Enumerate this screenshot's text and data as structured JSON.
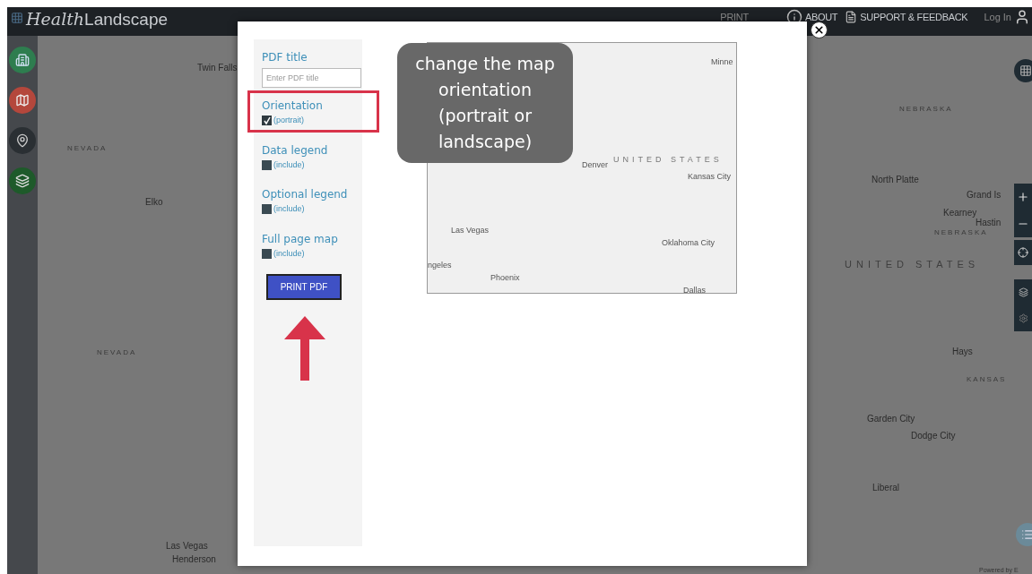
{
  "header": {
    "logo": {
      "italic_part": "Health",
      "rest": "Landscape"
    },
    "nav": [
      {
        "label": "PRINT",
        "kind": "print"
      },
      {
        "label": "ABOUT",
        "kind": "about"
      },
      {
        "label": "SUPPORT & FEEDBACK",
        "kind": "support"
      }
    ],
    "login": "Log In"
  },
  "map": {
    "labels": [
      {
        "text": "Twin Falls",
        "kind": "city"
      },
      {
        "text": "NEVADA",
        "kind": "region"
      },
      {
        "text": "Elko",
        "kind": "city"
      },
      {
        "text": "NEVADA",
        "kind": "region"
      },
      {
        "text": "Las Vegas",
        "kind": "city"
      },
      {
        "text": "Henderson",
        "kind": "city"
      },
      {
        "text": "NEBRASKA",
        "kind": "region"
      },
      {
        "text": "North Platte",
        "kind": "city"
      },
      {
        "text": "Grand Is",
        "kind": "city"
      },
      {
        "text": "Kearney",
        "kind": "city"
      },
      {
        "text": "Hastin",
        "kind": "city"
      },
      {
        "text": "NEBRASKA",
        "kind": "region"
      },
      {
        "text": "UNITED STATES",
        "kind": "country"
      },
      {
        "text": "Hays",
        "kind": "city"
      },
      {
        "text": "KANSAS",
        "kind": "region"
      },
      {
        "text": "Garden City",
        "kind": "city"
      },
      {
        "text": "Dodge City",
        "kind": "city"
      },
      {
        "text": "Liberal",
        "kind": "city"
      },
      {
        "text": "Powered by E",
        "kind": "credit"
      }
    ]
  },
  "modal": {
    "pdf_title": {
      "label": "PDF title",
      "placeholder": "Enter PDF title"
    },
    "options": [
      {
        "label": "Orientation",
        "value": "(portrait)",
        "checked": true,
        "highlighted": true
      },
      {
        "label": "Data legend",
        "value": "(include)",
        "checked": false,
        "highlighted": false
      },
      {
        "label": "Optional legend",
        "value": "(include)",
        "checked": false,
        "highlighted": false
      },
      {
        "label": "Full page map",
        "value": "(include)",
        "checked": false,
        "highlighted": false
      }
    ],
    "print_button": "PRINT PDF",
    "preview": {
      "labels": [
        {
          "text": "Minne",
          "kind": "city"
        },
        {
          "text": "UNITED STATES",
          "kind": "country"
        },
        {
          "text": "Denver",
          "kind": "city"
        },
        {
          "text": "Kansas City",
          "kind": "city"
        },
        {
          "text": "Las Vegas",
          "kind": "city"
        },
        {
          "text": "Oklahoma City",
          "kind": "city"
        },
        {
          "text": "ngeles",
          "kind": "city"
        },
        {
          "text": "Phoenix",
          "kind": "city"
        },
        {
          "text": "Dallas",
          "kind": "city"
        }
      ]
    }
  },
  "callout": {
    "text": "change the map orientation (portrait or landscape)"
  }
}
